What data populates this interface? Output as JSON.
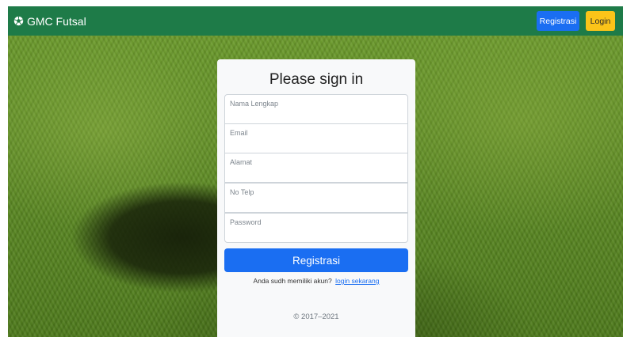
{
  "navbar": {
    "brand": "GMC Futsal",
    "brand_icon": "soccer-ball-icon",
    "register_button": "Registrasi",
    "login_button": "Login",
    "colors": {
      "navbar_bg": "#1e7b48",
      "register_bg": "#1a6ef2",
      "login_bg": "#fbc419"
    }
  },
  "form": {
    "title": "Please sign in",
    "fields": [
      {
        "placeholder": "Nama Lengkap",
        "value": ""
      },
      {
        "placeholder": "Email",
        "value": ""
      },
      {
        "placeholder": "Alamat",
        "value": ""
      },
      {
        "placeholder": "No Telp",
        "value": ""
      },
      {
        "placeholder": "Password",
        "value": ""
      }
    ],
    "submit_label": "Registrasi",
    "hint_text": "Anda sudh memiliki akun?",
    "hint_link": "login sekarang",
    "copyright": "© 2017–2021"
  }
}
